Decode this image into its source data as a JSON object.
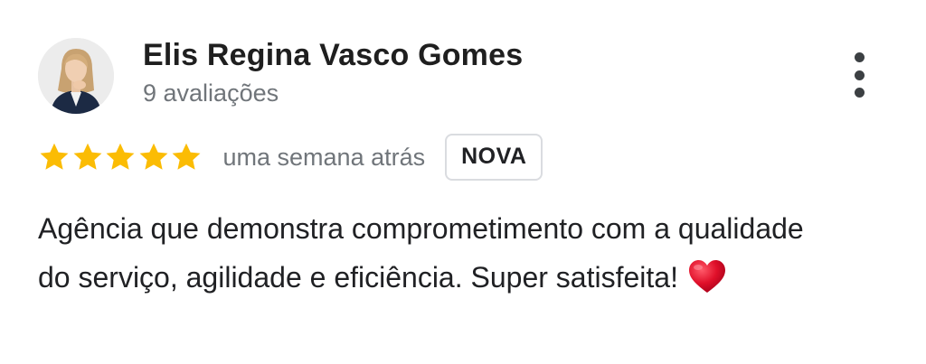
{
  "reviewer": {
    "name": "Elis Regina Vasco Gomes",
    "review_count": "9 avaliações",
    "avatar": "reviewer-photo"
  },
  "rating": {
    "stars": 5,
    "max_stars": 5,
    "star_color": "#fbbc04",
    "date": "uma semana atrás",
    "badge": "NOVA"
  },
  "review": {
    "text": "Agência que demonstra comprometimento com a qualidade do serviço, agilidade e eficiência. Super satisfeita!",
    "emoji": "heart-icon",
    "emoji_color": "#e0102a"
  },
  "menu": {
    "icon": "more-vert-icon"
  }
}
